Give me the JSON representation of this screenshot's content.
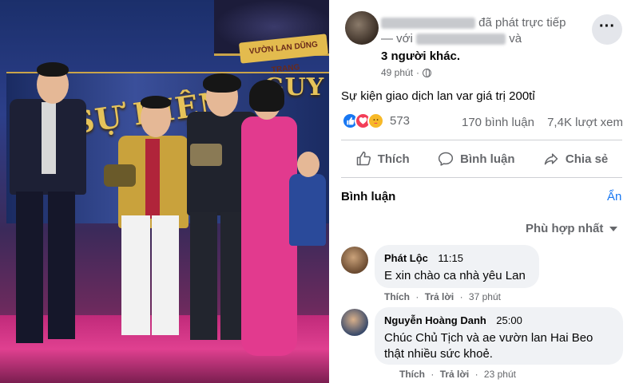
{
  "video": {
    "banner_main": "SỰ KIỆN",
    "banner_side": "GUY",
    "logo_text": "VƯỜN LAN DŨNG TRANG"
  },
  "post": {
    "header": {
      "line1_suffix": "đã phát trực tiếp",
      "line2_prefix": "— với",
      "line2_suffix": "và",
      "line3": "3 người khác.",
      "time": "49 phút"
    },
    "more_label": "···",
    "caption": "Sự kiện giao dịch lan var giá trị 200tỉ",
    "reactions": {
      "icons": [
        "like-icon",
        "love-icon",
        "care-icon"
      ],
      "count": "573"
    },
    "stats": {
      "comments": "170 bình luận",
      "views": "7,4K lượt xem"
    },
    "actions": {
      "like": "Thích",
      "comment": "Bình luận",
      "share": "Chia sẻ"
    },
    "comments_section": {
      "header": "Bình luận",
      "hide": "Ẩn",
      "sort": "Phù hợp nhất"
    },
    "comments": [
      {
        "name": "Phát Lộc",
        "time": "11:15",
        "text": "E xin chào ca nhà yêu Lan",
        "like": "Thích",
        "reply": "Trả lời",
        "ago": "37 phút"
      },
      {
        "name": "Nguyễn Hoàng Danh",
        "time": "25:00",
        "text": "Chúc Chủ Tịch và ae vườn lan Hai Beo thật nhiều sức khoẻ.",
        "like": "Thích",
        "reply": "Trả lời",
        "ago": "23 phút"
      }
    ]
  },
  "colors": {
    "accent": "#1877f2",
    "muted": "#65676b",
    "bubble": "#f0f2f5"
  }
}
